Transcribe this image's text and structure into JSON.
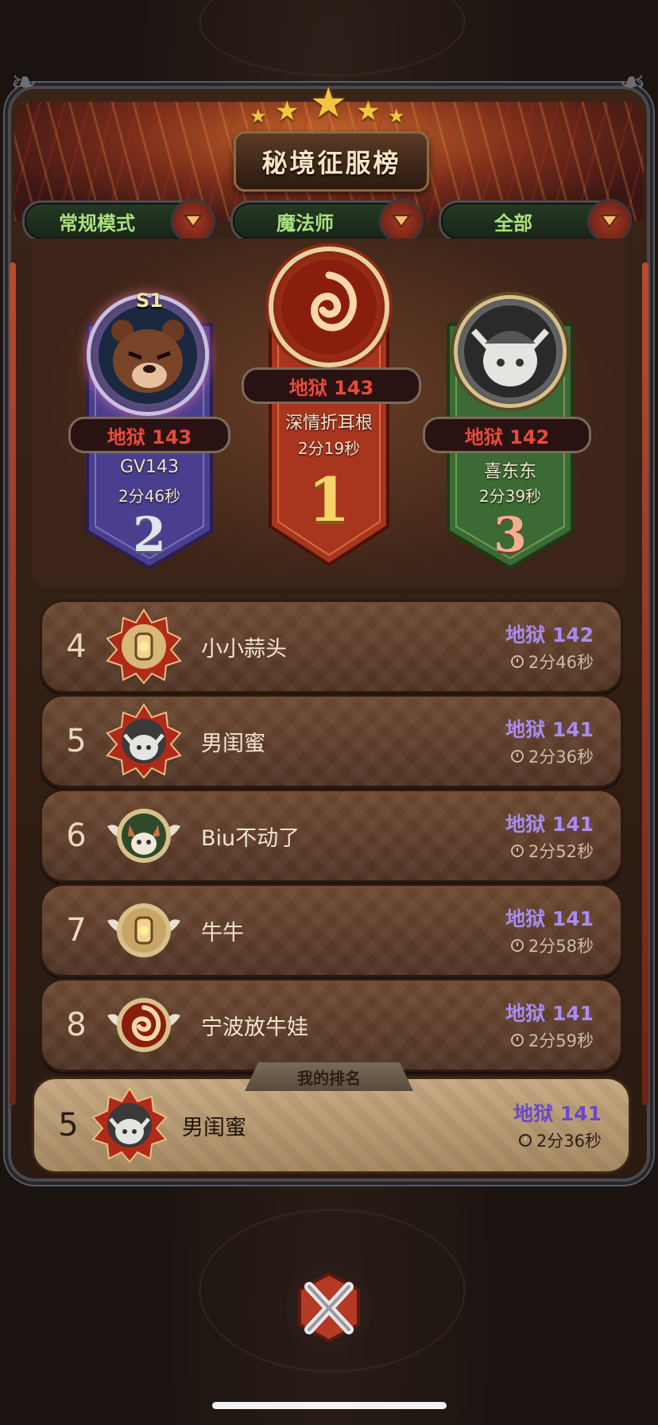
{
  "header": {
    "title": "秘境征服榜"
  },
  "filters": [
    {
      "label": "常规模式"
    },
    {
      "label": "魔法师"
    },
    {
      "label": "全部"
    }
  ],
  "podium": {
    "first": {
      "rank": "1",
      "level": "地狱 143",
      "name": "深情折耳根",
      "time": "2分19秒"
    },
    "second": {
      "rank": "2",
      "level": "地狱 143",
      "name": "GV143",
      "time": "2分46秒",
      "season": "S1"
    },
    "third": {
      "rank": "3",
      "level": "地狱 142",
      "name": "喜东东",
      "time": "2分39秒"
    }
  },
  "list": [
    {
      "rank": "4",
      "name": "小小蒜头",
      "level": "地狱 142",
      "time": "2分46秒",
      "avatar": "lantern-icon"
    },
    {
      "rank": "5",
      "name": "男闺蜜",
      "level": "地狱 141",
      "time": "2分36秒",
      "avatar": "elf-avatar"
    },
    {
      "rank": "6",
      "name": "Biu不动了",
      "level": "地狱 141",
      "time": "2分52秒",
      "avatar": "fox-avatar"
    },
    {
      "rank": "7",
      "name": "牛牛",
      "level": "地狱 141",
      "time": "2分58秒",
      "avatar": "lantern-icon"
    },
    {
      "rank": "8",
      "name": "宁波放牛娃",
      "level": "地狱 141",
      "time": "2分59秒",
      "avatar": "fire-swirl-icon"
    }
  ],
  "my_rank": {
    "tag": "我的排名",
    "rank": "5",
    "name": "男闺蜜",
    "level": "地狱 141",
    "time": "2分36秒"
  },
  "colors": {
    "level_purple": "#a98cf0",
    "level_red": "#e94a3c",
    "filter_green": "#a9e27e",
    "gold": "#f4c542"
  }
}
